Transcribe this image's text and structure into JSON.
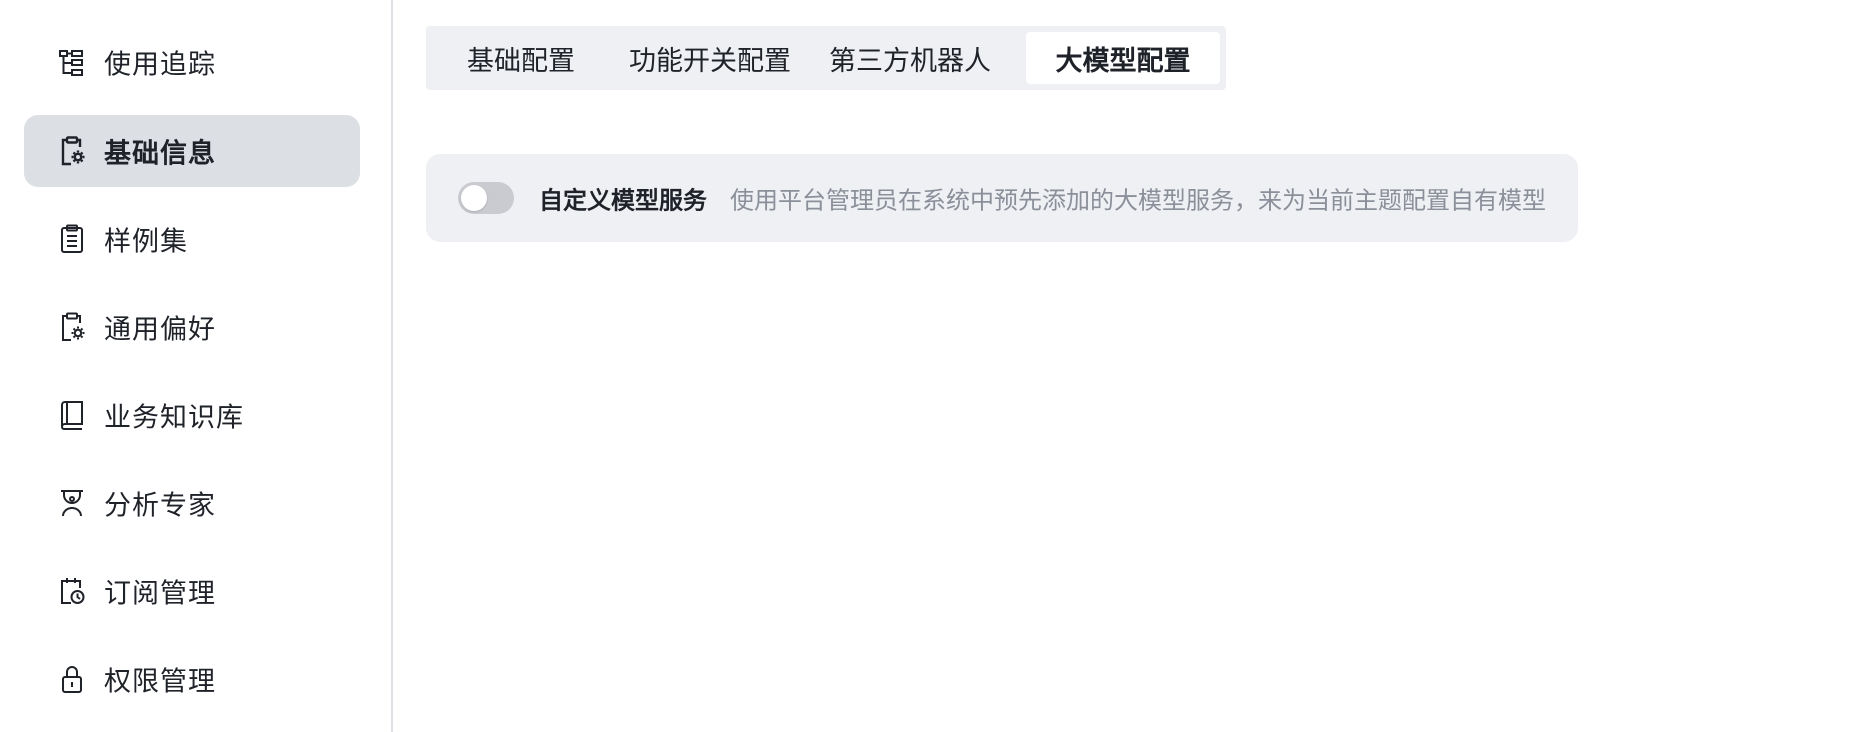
{
  "sidebar": {
    "items": [
      {
        "label": "使用追踪",
        "icon": "tree-structure-icon",
        "active": false
      },
      {
        "label": "基础信息",
        "icon": "clipboard-gear-icon",
        "active": true
      },
      {
        "label": "样例集",
        "icon": "clipboard-list-icon",
        "active": false
      },
      {
        "label": "通用偏好",
        "icon": "clipboard-gear-icon",
        "active": false
      },
      {
        "label": "业务知识库",
        "icon": "book-icon",
        "active": false
      },
      {
        "label": "分析专家",
        "icon": "expert-icon",
        "active": false
      },
      {
        "label": "订阅管理",
        "icon": "calendar-clock-icon",
        "active": false
      },
      {
        "label": "权限管理",
        "icon": "lock-icon",
        "active": false
      }
    ]
  },
  "tabs": {
    "items": [
      {
        "label": "基础配置",
        "active": false
      },
      {
        "label": "功能开关配置",
        "active": false
      },
      {
        "label": "第三方机器人",
        "active": false
      },
      {
        "label": "大模型配置",
        "active": true
      }
    ]
  },
  "setting": {
    "title": "自定义模型服务",
    "description": "使用平台管理员在系统中预先添加的大模型服务，来为当前主题配置自有模型",
    "enabled": false
  },
  "colors": {
    "active_bg": "#dcdfe4",
    "panel_bg": "#eff0f4",
    "toggle_off": "#c9cbd1",
    "muted_text": "#8a8f99"
  }
}
